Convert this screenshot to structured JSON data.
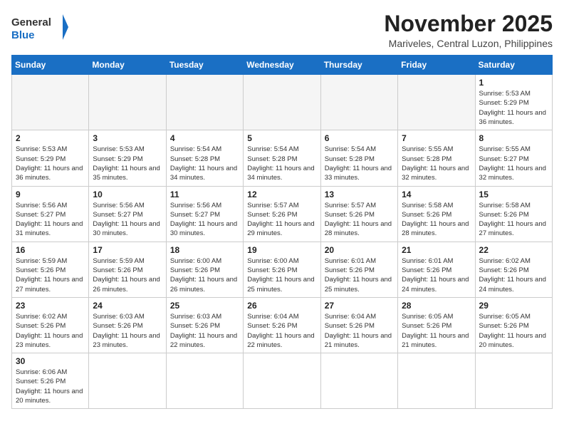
{
  "header": {
    "logo_general": "General",
    "logo_blue": "Blue",
    "month_title": "November 2025",
    "location": "Mariveles, Central Luzon, Philippines"
  },
  "weekdays": [
    "Sunday",
    "Monday",
    "Tuesday",
    "Wednesday",
    "Thursday",
    "Friday",
    "Saturday"
  ],
  "days": [
    {
      "num": "",
      "sunrise": "",
      "sunset": "",
      "daylight": "",
      "empty": true
    },
    {
      "num": "",
      "sunrise": "",
      "sunset": "",
      "daylight": "",
      "empty": true
    },
    {
      "num": "",
      "sunrise": "",
      "sunset": "",
      "daylight": "",
      "empty": true
    },
    {
      "num": "",
      "sunrise": "",
      "sunset": "",
      "daylight": "",
      "empty": true
    },
    {
      "num": "",
      "sunrise": "",
      "sunset": "",
      "daylight": "",
      "empty": true
    },
    {
      "num": "",
      "sunrise": "",
      "sunset": "",
      "daylight": "",
      "empty": true
    },
    {
      "num": "1",
      "sunrise": "Sunrise: 5:53 AM",
      "sunset": "Sunset: 5:29 PM",
      "daylight": "Daylight: 11 hours and 36 minutes.",
      "empty": false
    },
    {
      "num": "2",
      "sunrise": "Sunrise: 5:53 AM",
      "sunset": "Sunset: 5:29 PM",
      "daylight": "Daylight: 11 hours and 36 minutes.",
      "empty": false
    },
    {
      "num": "3",
      "sunrise": "Sunrise: 5:53 AM",
      "sunset": "Sunset: 5:29 PM",
      "daylight": "Daylight: 11 hours and 35 minutes.",
      "empty": false
    },
    {
      "num": "4",
      "sunrise": "Sunrise: 5:54 AM",
      "sunset": "Sunset: 5:28 PM",
      "daylight": "Daylight: 11 hours and 34 minutes.",
      "empty": false
    },
    {
      "num": "5",
      "sunrise": "Sunrise: 5:54 AM",
      "sunset": "Sunset: 5:28 PM",
      "daylight": "Daylight: 11 hours and 34 minutes.",
      "empty": false
    },
    {
      "num": "6",
      "sunrise": "Sunrise: 5:54 AM",
      "sunset": "Sunset: 5:28 PM",
      "daylight": "Daylight: 11 hours and 33 minutes.",
      "empty": false
    },
    {
      "num": "7",
      "sunrise": "Sunrise: 5:55 AM",
      "sunset": "Sunset: 5:28 PM",
      "daylight": "Daylight: 11 hours and 32 minutes.",
      "empty": false
    },
    {
      "num": "8",
      "sunrise": "Sunrise: 5:55 AM",
      "sunset": "Sunset: 5:27 PM",
      "daylight": "Daylight: 11 hours and 32 minutes.",
      "empty": false
    },
    {
      "num": "9",
      "sunrise": "Sunrise: 5:56 AM",
      "sunset": "Sunset: 5:27 PM",
      "daylight": "Daylight: 11 hours and 31 minutes.",
      "empty": false
    },
    {
      "num": "10",
      "sunrise": "Sunrise: 5:56 AM",
      "sunset": "Sunset: 5:27 PM",
      "daylight": "Daylight: 11 hours and 30 minutes.",
      "empty": false
    },
    {
      "num": "11",
      "sunrise": "Sunrise: 5:56 AM",
      "sunset": "Sunset: 5:27 PM",
      "daylight": "Daylight: 11 hours and 30 minutes.",
      "empty": false
    },
    {
      "num": "12",
      "sunrise": "Sunrise: 5:57 AM",
      "sunset": "Sunset: 5:26 PM",
      "daylight": "Daylight: 11 hours and 29 minutes.",
      "empty": false
    },
    {
      "num": "13",
      "sunrise": "Sunrise: 5:57 AM",
      "sunset": "Sunset: 5:26 PM",
      "daylight": "Daylight: 11 hours and 28 minutes.",
      "empty": false
    },
    {
      "num": "14",
      "sunrise": "Sunrise: 5:58 AM",
      "sunset": "Sunset: 5:26 PM",
      "daylight": "Daylight: 11 hours and 28 minutes.",
      "empty": false
    },
    {
      "num": "15",
      "sunrise": "Sunrise: 5:58 AM",
      "sunset": "Sunset: 5:26 PM",
      "daylight": "Daylight: 11 hours and 27 minutes.",
      "empty": false
    },
    {
      "num": "16",
      "sunrise": "Sunrise: 5:59 AM",
      "sunset": "Sunset: 5:26 PM",
      "daylight": "Daylight: 11 hours and 27 minutes.",
      "empty": false
    },
    {
      "num": "17",
      "sunrise": "Sunrise: 5:59 AM",
      "sunset": "Sunset: 5:26 PM",
      "daylight": "Daylight: 11 hours and 26 minutes.",
      "empty": false
    },
    {
      "num": "18",
      "sunrise": "Sunrise: 6:00 AM",
      "sunset": "Sunset: 5:26 PM",
      "daylight": "Daylight: 11 hours and 26 minutes.",
      "empty": false
    },
    {
      "num": "19",
      "sunrise": "Sunrise: 6:00 AM",
      "sunset": "Sunset: 5:26 PM",
      "daylight": "Daylight: 11 hours and 25 minutes.",
      "empty": false
    },
    {
      "num": "20",
      "sunrise": "Sunrise: 6:01 AM",
      "sunset": "Sunset: 5:26 PM",
      "daylight": "Daylight: 11 hours and 25 minutes.",
      "empty": false
    },
    {
      "num": "21",
      "sunrise": "Sunrise: 6:01 AM",
      "sunset": "Sunset: 5:26 PM",
      "daylight": "Daylight: 11 hours and 24 minutes.",
      "empty": false
    },
    {
      "num": "22",
      "sunrise": "Sunrise: 6:02 AM",
      "sunset": "Sunset: 5:26 PM",
      "daylight": "Daylight: 11 hours and 24 minutes.",
      "empty": false
    },
    {
      "num": "23",
      "sunrise": "Sunrise: 6:02 AM",
      "sunset": "Sunset: 5:26 PM",
      "daylight": "Daylight: 11 hours and 23 minutes.",
      "empty": false
    },
    {
      "num": "24",
      "sunrise": "Sunrise: 6:03 AM",
      "sunset": "Sunset: 5:26 PM",
      "daylight": "Daylight: 11 hours and 23 minutes.",
      "empty": false
    },
    {
      "num": "25",
      "sunrise": "Sunrise: 6:03 AM",
      "sunset": "Sunset: 5:26 PM",
      "daylight": "Daylight: 11 hours and 22 minutes.",
      "empty": false
    },
    {
      "num": "26",
      "sunrise": "Sunrise: 6:04 AM",
      "sunset": "Sunset: 5:26 PM",
      "daylight": "Daylight: 11 hours and 22 minutes.",
      "empty": false
    },
    {
      "num": "27",
      "sunrise": "Sunrise: 6:04 AM",
      "sunset": "Sunset: 5:26 PM",
      "daylight": "Daylight: 11 hours and 21 minutes.",
      "empty": false
    },
    {
      "num": "28",
      "sunrise": "Sunrise: 6:05 AM",
      "sunset": "Sunset: 5:26 PM",
      "daylight": "Daylight: 11 hours and 21 minutes.",
      "empty": false
    },
    {
      "num": "29",
      "sunrise": "Sunrise: 6:05 AM",
      "sunset": "Sunset: 5:26 PM",
      "daylight": "Daylight: 11 hours and 20 minutes.",
      "empty": false
    },
    {
      "num": "30",
      "sunrise": "Sunrise: 6:06 AM",
      "sunset": "Sunset: 5:26 PM",
      "daylight": "Daylight: 11 hours and 20 minutes.",
      "empty": false
    }
  ]
}
